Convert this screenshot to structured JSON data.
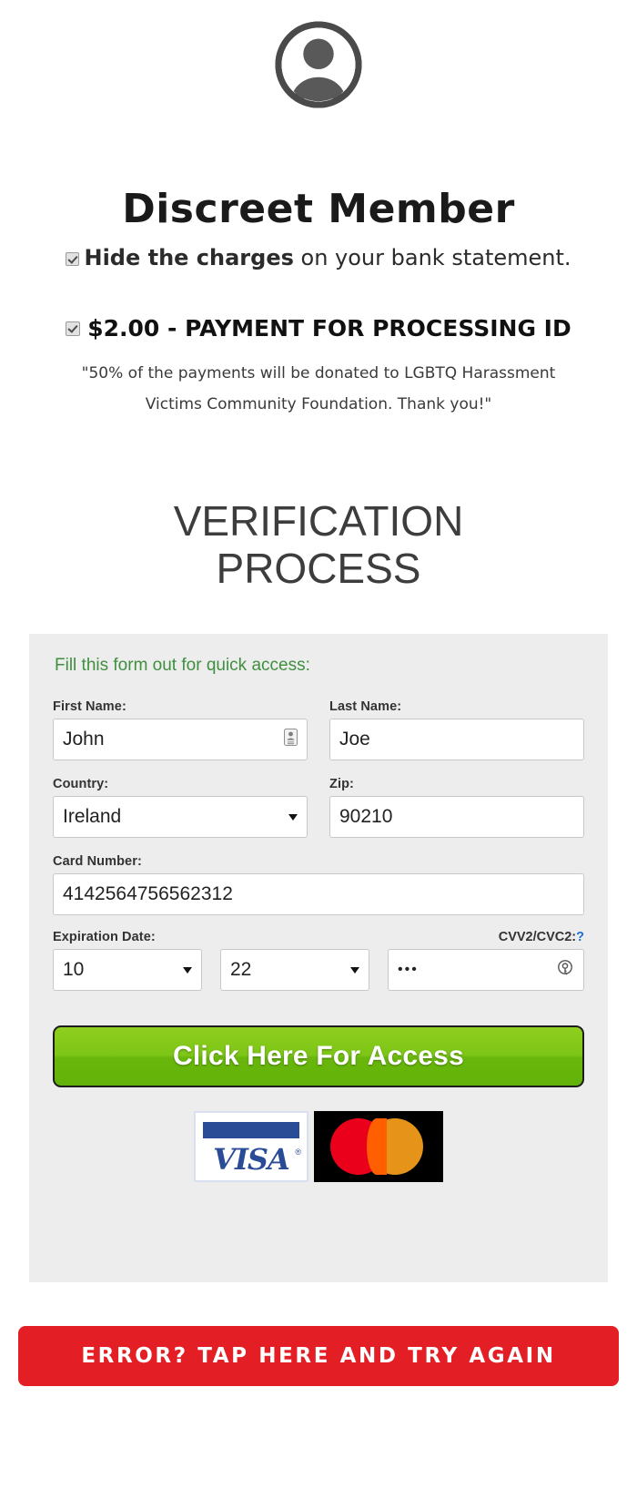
{
  "header": {
    "avatar_icon": "user-avatar-icon",
    "title": "Discreet Member",
    "hide_charges_bold": "Hide the charges",
    "hide_charges_rest": " on your bank statement.",
    "checkbox_hide_checked": true
  },
  "payment": {
    "amount_and_label": "$2.00 - PAYMENT FOR PROCESSING ID",
    "checkbox_payment_checked": true,
    "donation_note_line1": "\"50% of the payments will be donated to LGBTQ Harassment",
    "donation_note_line2": "Victims Community Foundation. Thank you!\""
  },
  "verification": {
    "title_line1": "VERIFICATION",
    "title_line2": "PROCESS",
    "form_intro": "Fill this form out for quick access:"
  },
  "form": {
    "first_name": {
      "label": "First Name:",
      "value": "John",
      "icon": "contact-card-icon"
    },
    "last_name": {
      "label": "Last Name:",
      "value": "Joe"
    },
    "country": {
      "label": "Country:",
      "value": "Ireland",
      "icon": "chevron-down-icon"
    },
    "zip": {
      "label": "Zip:",
      "value": "90210"
    },
    "card_number": {
      "label": "Card Number:",
      "value": "4142564756562312"
    },
    "expiration": {
      "label": "Expiration Date:",
      "month_value": "10",
      "year_value": "22"
    },
    "cvv": {
      "label": "CVV2/CVC2:",
      "help_marker": "?",
      "value": "•••",
      "icon": "password-key-icon"
    },
    "submit_label": "Click Here For Access"
  },
  "cards": {
    "visa_label": "VISA",
    "visa_reg": "®",
    "mastercard_label": "mastercard-logo"
  },
  "error_bar": {
    "label": "ERROR? TAP HERE AND TRY AGAIN"
  },
  "colors": {
    "accent_green": "#7dc517",
    "error_red": "#e31e24",
    "intro_green": "#3f8f3f",
    "help_blue": "#1d6fd0",
    "panel_gray": "#ededed"
  }
}
